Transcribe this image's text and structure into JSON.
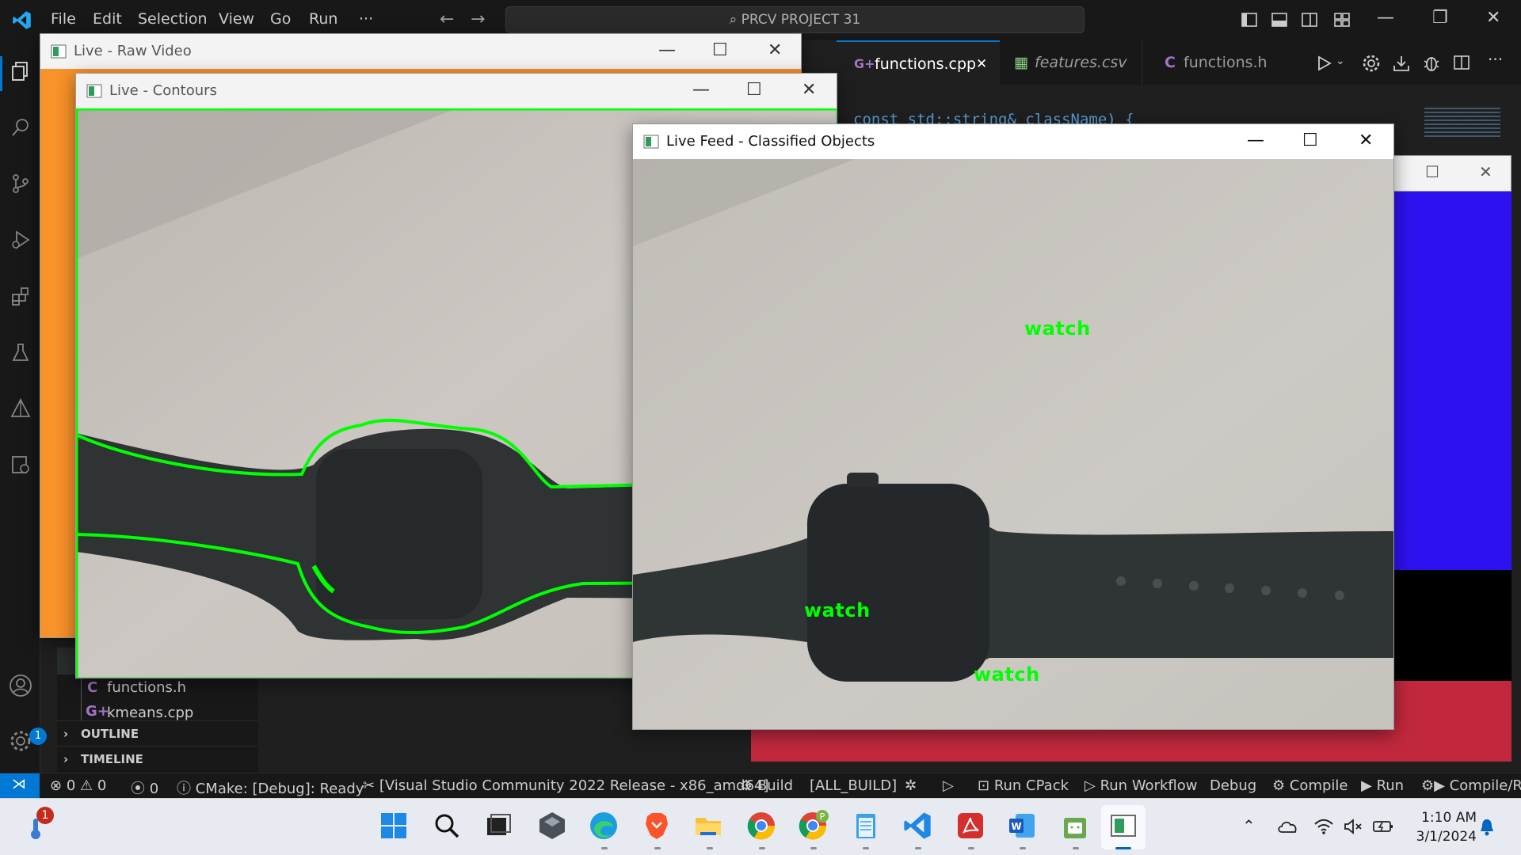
{
  "vscode": {
    "menu": [
      "File",
      "Edit",
      "Selection",
      "View",
      "Go",
      "Run",
      "···"
    ],
    "search_text": "PRCV PROJECT 31",
    "tabs": [
      {
        "label": "functions.cpp",
        "close": "✕"
      },
      {
        "label": "features.csv"
      },
      {
        "label": "functions.h"
      }
    ],
    "code_line": "const std::string& className) {",
    "sidebar": {
      "files": [
        "functions.h",
        "kmeans.cpp"
      ],
      "outline": "OUTLINE",
      "timeline": "TIMELINE"
    },
    "accounts_badge": "1",
    "status": {
      "errors": "0",
      "warnings": "0",
      "ports": "0",
      "cmake": "CMake: [Debug]: Ready",
      "kit": "[Visual Studio Community 2022 Release - x86_amd64]",
      "build": "Build",
      "target": "[ALL_BUILD]",
      "cpack": "Run CPack",
      "workflow": "Run Workflow",
      "debug": "Debug",
      "compile": "Compile",
      "run": "Run",
      "compile_run": "Compile/Ru"
    },
    "colors": {
      "accent": "#0078d4",
      "bg": "#1f1f1f",
      "chrome": "#181818"
    }
  },
  "windows": {
    "raw": {
      "title": "Live - Raw Video"
    },
    "contours": {
      "title": "Live - Contours",
      "contour_color": "#00ff00"
    },
    "classified": {
      "title": "Live Feed - Classified Objects",
      "labels": [
        "watch",
        "watch",
        "watch"
      ]
    }
  },
  "taskbar": {
    "notification_badge": "1",
    "time": "1:10 AM",
    "date": "3/1/2024",
    "apps": [
      "start-icon",
      "search-icon",
      "task-view-icon",
      "unity-icon",
      "edge-icon",
      "brave-icon",
      "file-explorer-icon",
      "chrome-icon",
      "chrome-profile-icon",
      "notepad-icon",
      "vscode-icon",
      "acrobat-icon",
      "word-icon",
      "android-icon",
      "opencv-window-icon"
    ]
  }
}
